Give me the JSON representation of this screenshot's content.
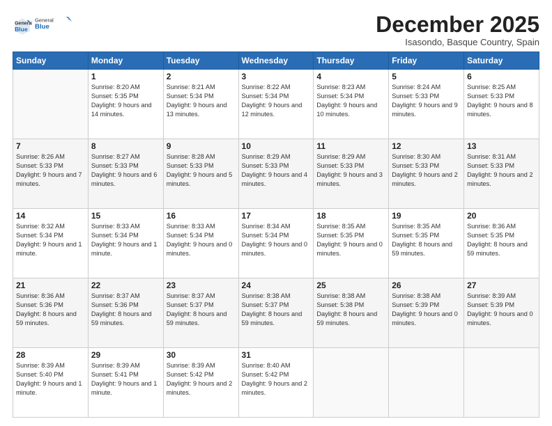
{
  "logo": {
    "general": "General",
    "blue": "Blue"
  },
  "header": {
    "month": "December 2025",
    "location": "Isasondo, Basque Country, Spain"
  },
  "weekdays": [
    "Sunday",
    "Monday",
    "Tuesday",
    "Wednesday",
    "Thursday",
    "Friday",
    "Saturday"
  ],
  "weeks": [
    [
      {
        "day": "",
        "sunrise": "",
        "sunset": "",
        "daylight": ""
      },
      {
        "day": "1",
        "sunrise": "Sunrise: 8:20 AM",
        "sunset": "Sunset: 5:35 PM",
        "daylight": "Daylight: 9 hours and 14 minutes."
      },
      {
        "day": "2",
        "sunrise": "Sunrise: 8:21 AM",
        "sunset": "Sunset: 5:34 PM",
        "daylight": "Daylight: 9 hours and 13 minutes."
      },
      {
        "day": "3",
        "sunrise": "Sunrise: 8:22 AM",
        "sunset": "Sunset: 5:34 PM",
        "daylight": "Daylight: 9 hours and 12 minutes."
      },
      {
        "day": "4",
        "sunrise": "Sunrise: 8:23 AM",
        "sunset": "Sunset: 5:34 PM",
        "daylight": "Daylight: 9 hours and 10 minutes."
      },
      {
        "day": "5",
        "sunrise": "Sunrise: 8:24 AM",
        "sunset": "Sunset: 5:33 PM",
        "daylight": "Daylight: 9 hours and 9 minutes."
      },
      {
        "day": "6",
        "sunrise": "Sunrise: 8:25 AM",
        "sunset": "Sunset: 5:33 PM",
        "daylight": "Daylight: 9 hours and 8 minutes."
      }
    ],
    [
      {
        "day": "7",
        "sunrise": "Sunrise: 8:26 AM",
        "sunset": "Sunset: 5:33 PM",
        "daylight": "Daylight: 9 hours and 7 minutes."
      },
      {
        "day": "8",
        "sunrise": "Sunrise: 8:27 AM",
        "sunset": "Sunset: 5:33 PM",
        "daylight": "Daylight: 9 hours and 6 minutes."
      },
      {
        "day": "9",
        "sunrise": "Sunrise: 8:28 AM",
        "sunset": "Sunset: 5:33 PM",
        "daylight": "Daylight: 9 hours and 5 minutes."
      },
      {
        "day": "10",
        "sunrise": "Sunrise: 8:29 AM",
        "sunset": "Sunset: 5:33 PM",
        "daylight": "Daylight: 9 hours and 4 minutes."
      },
      {
        "day": "11",
        "sunrise": "Sunrise: 8:29 AM",
        "sunset": "Sunset: 5:33 PM",
        "daylight": "Daylight: 9 hours and 3 minutes."
      },
      {
        "day": "12",
        "sunrise": "Sunrise: 8:30 AM",
        "sunset": "Sunset: 5:33 PM",
        "daylight": "Daylight: 9 hours and 2 minutes."
      },
      {
        "day": "13",
        "sunrise": "Sunrise: 8:31 AM",
        "sunset": "Sunset: 5:33 PM",
        "daylight": "Daylight: 9 hours and 2 minutes."
      }
    ],
    [
      {
        "day": "14",
        "sunrise": "Sunrise: 8:32 AM",
        "sunset": "Sunset: 5:34 PM",
        "daylight": "Daylight: 9 hours and 1 minute."
      },
      {
        "day": "15",
        "sunrise": "Sunrise: 8:33 AM",
        "sunset": "Sunset: 5:34 PM",
        "daylight": "Daylight: 9 hours and 1 minute."
      },
      {
        "day": "16",
        "sunrise": "Sunrise: 8:33 AM",
        "sunset": "Sunset: 5:34 PM",
        "daylight": "Daylight: 9 hours and 0 minutes."
      },
      {
        "day": "17",
        "sunrise": "Sunrise: 8:34 AM",
        "sunset": "Sunset: 5:34 PM",
        "daylight": "Daylight: 9 hours and 0 minutes."
      },
      {
        "day": "18",
        "sunrise": "Sunrise: 8:35 AM",
        "sunset": "Sunset: 5:35 PM",
        "daylight": "Daylight: 9 hours and 0 minutes."
      },
      {
        "day": "19",
        "sunrise": "Sunrise: 8:35 AM",
        "sunset": "Sunset: 5:35 PM",
        "daylight": "Daylight: 8 hours and 59 minutes."
      },
      {
        "day": "20",
        "sunrise": "Sunrise: 8:36 AM",
        "sunset": "Sunset: 5:35 PM",
        "daylight": "Daylight: 8 hours and 59 minutes."
      }
    ],
    [
      {
        "day": "21",
        "sunrise": "Sunrise: 8:36 AM",
        "sunset": "Sunset: 5:36 PM",
        "daylight": "Daylight: 8 hours and 59 minutes."
      },
      {
        "day": "22",
        "sunrise": "Sunrise: 8:37 AM",
        "sunset": "Sunset: 5:36 PM",
        "daylight": "Daylight: 8 hours and 59 minutes."
      },
      {
        "day": "23",
        "sunrise": "Sunrise: 8:37 AM",
        "sunset": "Sunset: 5:37 PM",
        "daylight": "Daylight: 8 hours and 59 minutes."
      },
      {
        "day": "24",
        "sunrise": "Sunrise: 8:38 AM",
        "sunset": "Sunset: 5:37 PM",
        "daylight": "Daylight: 8 hours and 59 minutes."
      },
      {
        "day": "25",
        "sunrise": "Sunrise: 8:38 AM",
        "sunset": "Sunset: 5:38 PM",
        "daylight": "Daylight: 8 hours and 59 minutes."
      },
      {
        "day": "26",
        "sunrise": "Sunrise: 8:38 AM",
        "sunset": "Sunset: 5:39 PM",
        "daylight": "Daylight: 9 hours and 0 minutes."
      },
      {
        "day": "27",
        "sunrise": "Sunrise: 8:39 AM",
        "sunset": "Sunset: 5:39 PM",
        "daylight": "Daylight: 9 hours and 0 minutes."
      }
    ],
    [
      {
        "day": "28",
        "sunrise": "Sunrise: 8:39 AM",
        "sunset": "Sunset: 5:40 PM",
        "daylight": "Daylight: 9 hours and 1 minute."
      },
      {
        "day": "29",
        "sunrise": "Sunrise: 8:39 AM",
        "sunset": "Sunset: 5:41 PM",
        "daylight": "Daylight: 9 hours and 1 minute."
      },
      {
        "day": "30",
        "sunrise": "Sunrise: 8:39 AM",
        "sunset": "Sunset: 5:42 PM",
        "daylight": "Daylight: 9 hours and 2 minutes."
      },
      {
        "day": "31",
        "sunrise": "Sunrise: 8:40 AM",
        "sunset": "Sunset: 5:42 PM",
        "daylight": "Daylight: 9 hours and 2 minutes."
      },
      {
        "day": "",
        "sunrise": "",
        "sunset": "",
        "daylight": ""
      },
      {
        "day": "",
        "sunrise": "",
        "sunset": "",
        "daylight": ""
      },
      {
        "day": "",
        "sunrise": "",
        "sunset": "",
        "daylight": ""
      }
    ]
  ]
}
